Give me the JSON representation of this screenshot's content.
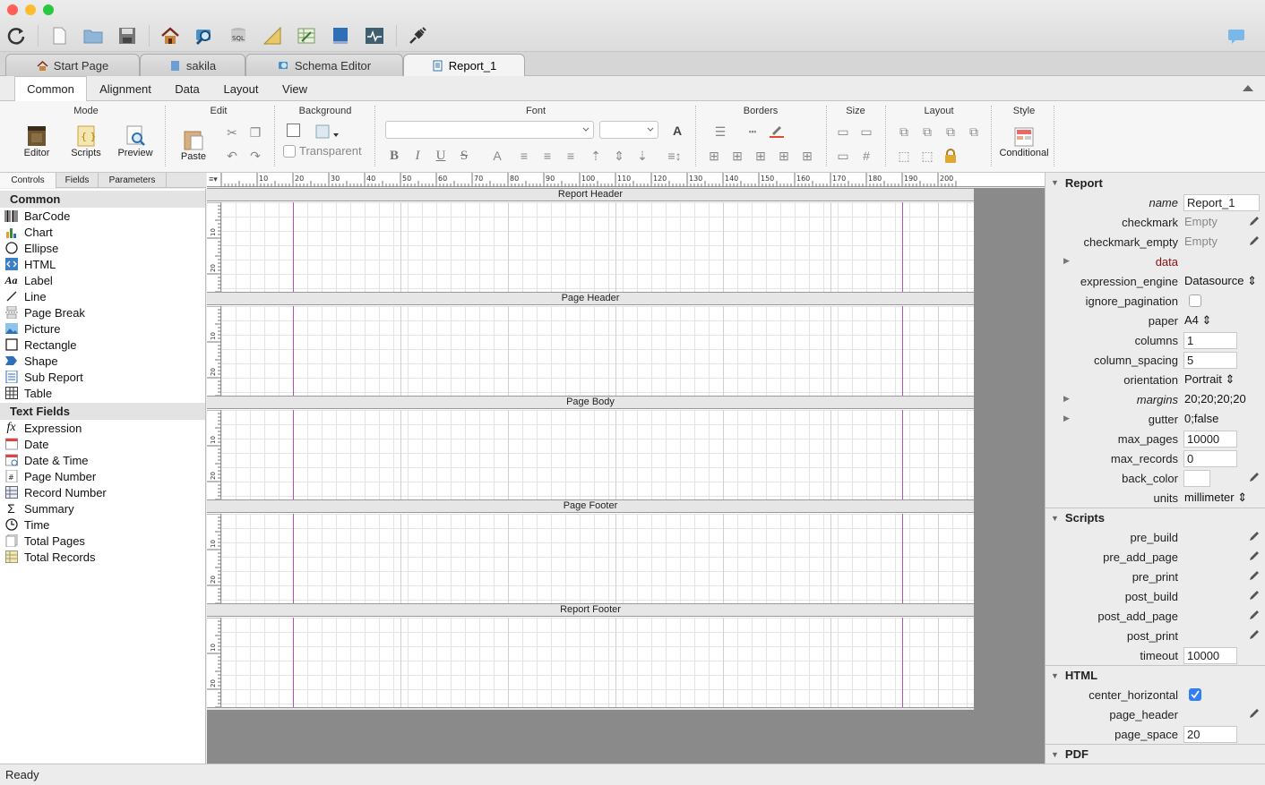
{
  "window": {
    "traffic_lights": [
      "#ff5f57",
      "#febc2e",
      "#28c840"
    ]
  },
  "toolbar": {
    "icons": [
      "refresh-icon",
      "new-file-icon",
      "open-folder-icon",
      "save-icon",
      "home-icon",
      "db-search-icon",
      "sql-icon",
      "ruler-icon",
      "table-edit-icon",
      "book-icon",
      "activity-icon",
      "plug-icon",
      "chat-icon"
    ]
  },
  "doc_tabs": [
    {
      "label": "Start Page"
    },
    {
      "label": "sakila"
    },
    {
      "label": "Schema Editor"
    },
    {
      "label": "Report_1",
      "active": true
    }
  ],
  "ribbon_tabs": [
    {
      "label": "Common",
      "active": true
    },
    {
      "label": "Alignment"
    },
    {
      "label": "Data"
    },
    {
      "label": "Layout"
    },
    {
      "label": "View"
    }
  ],
  "ribbon": {
    "groups": {
      "mode": "Mode",
      "edit": "Edit",
      "background": "Background",
      "font": "Font",
      "borders": "Borders",
      "size": "Size",
      "layout": "Layout",
      "style": "Style"
    },
    "editor": "Editor",
    "scripts": "Scripts",
    "preview": "Preview",
    "paste": "Paste",
    "transparent": "Transparent",
    "conditional": "Conditional",
    "font_buttons": {
      "bold": "B",
      "italic": "I",
      "underline": "U",
      "strike": "S",
      "color": "A"
    }
  },
  "left_tabs": [
    {
      "label": "Controls",
      "active": true
    },
    {
      "label": "Fields"
    },
    {
      "label": "Parameters"
    }
  ],
  "palette": {
    "common_header": "Common",
    "common": [
      {
        "label": "BarCode",
        "icon": "barcode-icon"
      },
      {
        "label": "Chart",
        "icon": "chart-icon"
      },
      {
        "label": "Ellipse",
        "icon": "ellipse-icon"
      },
      {
        "label": "HTML",
        "icon": "html-icon"
      },
      {
        "label": "Label",
        "icon": "label-icon"
      },
      {
        "label": "Line",
        "icon": "line-icon"
      },
      {
        "label": "Page Break",
        "icon": "page-break-icon"
      },
      {
        "label": "Picture",
        "icon": "picture-icon"
      },
      {
        "label": "Rectangle",
        "icon": "rectangle-icon"
      },
      {
        "label": "Shape",
        "icon": "shape-icon"
      },
      {
        "label": "Sub Report",
        "icon": "sub-report-icon"
      },
      {
        "label": "Table",
        "icon": "table-icon"
      }
    ],
    "text_header": "Text Fields",
    "text": [
      {
        "label": "Expression",
        "icon": "expression-icon"
      },
      {
        "label": "Date",
        "icon": "date-icon"
      },
      {
        "label": "Date & Time",
        "icon": "datetime-icon"
      },
      {
        "label": "Page Number",
        "icon": "page-number-icon"
      },
      {
        "label": "Record Number",
        "icon": "record-number-icon"
      },
      {
        "label": "Summary",
        "icon": "summary-icon"
      },
      {
        "label": "Time",
        "icon": "time-icon"
      },
      {
        "label": "Total Pages",
        "icon": "total-pages-icon"
      },
      {
        "label": "Total Records",
        "icon": "total-records-icon"
      }
    ]
  },
  "ruler": {
    "ticks": [
      "10",
      "20",
      "30",
      "40",
      "50",
      "60",
      "70",
      "80",
      "90",
      "100",
      "110",
      "120",
      "130",
      "140",
      "150",
      "160",
      "170",
      "180",
      "190",
      "200"
    ],
    "vticks": [
      "10",
      "20"
    ]
  },
  "bands": [
    {
      "label": "Report Header"
    },
    {
      "label": "Page Header"
    },
    {
      "label": "Page Body"
    },
    {
      "label": "Page Footer"
    },
    {
      "label": "Report Footer"
    }
  ],
  "props": {
    "report": {
      "title": "Report",
      "rows": [
        {
          "key": "name",
          "value": "Report_1",
          "type": "input-wide",
          "italic": true
        },
        {
          "key": "checkmark",
          "value": "Empty",
          "type": "gray",
          "pencil": true
        },
        {
          "key": "checkmark_empty",
          "value": "Empty",
          "type": "gray",
          "pencil": true
        },
        {
          "key": "data",
          "value": "",
          "type": "red",
          "expand": true
        },
        {
          "key": "expression_engine",
          "value": "Datasource ⇕",
          "type": "text"
        },
        {
          "key": "ignore_pagination",
          "value": "",
          "type": "checkbox"
        },
        {
          "key": "paper",
          "value": "A4 ⇕",
          "type": "text"
        },
        {
          "key": "columns",
          "value": "1",
          "type": "input"
        },
        {
          "key": "column_spacing",
          "value": "5",
          "type": "input"
        },
        {
          "key": "orientation",
          "value": "Portrait ⇕",
          "type": "text"
        },
        {
          "key": "margins",
          "value": "20;20;20;20",
          "type": "text",
          "italic": true,
          "expand": true
        },
        {
          "key": "gutter",
          "value": "0;false",
          "type": "text",
          "expand": true
        },
        {
          "key": "max_pages",
          "value": "10000",
          "type": "input"
        },
        {
          "key": "max_records",
          "value": "0",
          "type": "input"
        },
        {
          "key": "back_color",
          "value": "",
          "type": "color",
          "pencil": true
        },
        {
          "key": "units",
          "value": "millimeter ⇕",
          "type": "text"
        }
      ]
    },
    "scripts": {
      "title": "Scripts",
      "rows": [
        {
          "key": "pre_build",
          "value": "",
          "type": "none",
          "pencil": true
        },
        {
          "key": "pre_add_page",
          "value": "",
          "type": "none",
          "pencil": true
        },
        {
          "key": "pre_print",
          "value": "",
          "type": "none",
          "pencil": true
        },
        {
          "key": "post_build",
          "value": "",
          "type": "none",
          "pencil": true
        },
        {
          "key": "post_add_page",
          "value": "",
          "type": "none",
          "pencil": true
        },
        {
          "key": "post_print",
          "value": "",
          "type": "none",
          "pencil": true
        },
        {
          "key": "timeout",
          "value": "10000",
          "type": "input"
        }
      ]
    },
    "html": {
      "title": "HTML",
      "rows": [
        {
          "key": "center_horizontal",
          "value": "",
          "type": "checked"
        },
        {
          "key": "page_header",
          "value": "",
          "type": "none",
          "pencil": true
        },
        {
          "key": "page_space",
          "value": "20",
          "type": "input"
        }
      ]
    },
    "pdf": {
      "title": "PDF"
    }
  },
  "status": {
    "text": "Ready"
  },
  "colors": {
    "accent": "#2f7ff6",
    "margin_line": "#b44fb4"
  }
}
